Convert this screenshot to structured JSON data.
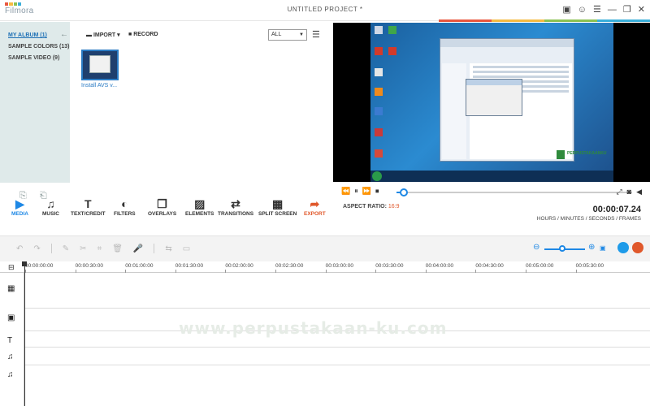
{
  "app": {
    "logo_text": "Filmora",
    "window_title": "UNTITLED PROJECT *",
    "logo_colors": [
      "#e9573f",
      "#f6bb42",
      "#8cc152",
      "#3bafda"
    ]
  },
  "window_controls": {
    "icons": [
      "save-icon",
      "user-icon",
      "menu-icon",
      "minimize-icon",
      "maximize-icon",
      "close-icon"
    ],
    "glyphs": [
      "▣",
      "☺",
      "☰",
      "—",
      "❐",
      "✕"
    ]
  },
  "library": {
    "albums": [
      {
        "label": "MY ALBUM (1)",
        "active": true
      },
      {
        "label": "SAMPLE COLORS (13)",
        "active": false
      },
      {
        "label": "SAMPLE VIDEO (9)",
        "active": false
      }
    ]
  },
  "media": {
    "import_label": "IMPORT",
    "record_label": "RECORD",
    "filter_value": "ALL",
    "clip_label": "Install AVS v..."
  },
  "preview": {
    "aspect_label": "ASPECT RATIO:",
    "aspect_value": "16:9",
    "timecode": "00:00:07.24",
    "timecode_format": "HOURS / MINUTES / SECONDS / FRAMES",
    "overlay_brand": "PERPUSTAKAANKU",
    "playback_progress": 0.03
  },
  "toolbar": {
    "tools": [
      {
        "label": "MEDIA",
        "icon": "media-icon",
        "glyph": "▶",
        "active": true
      },
      {
        "label": "MUSIC",
        "icon": "music-icon",
        "glyph": "♫",
        "active": false
      },
      {
        "label": "TEXT/CREDIT",
        "icon": "text-icon",
        "glyph": "T",
        "active": false
      },
      {
        "label": "FILTERS",
        "icon": "filters-icon",
        "glyph": "◐",
        "active": false
      },
      {
        "label": "OVERLAYS",
        "icon": "overlays-icon",
        "glyph": "❐",
        "active": false
      },
      {
        "label": "ELEMENTS",
        "icon": "elements-icon",
        "glyph": "▨",
        "active": false
      },
      {
        "label": "TRANSITIONS",
        "icon": "transitions-icon",
        "glyph": "⇄",
        "active": false
      },
      {
        "label": "SPLIT SCREEN",
        "icon": "split-screen-icon",
        "glyph": "▦",
        "active": false
      },
      {
        "label": "EXPORT",
        "icon": "export-icon",
        "glyph": "➦",
        "active": false
      }
    ]
  },
  "timeline": {
    "ticks": [
      "00:00:00:00",
      "00:00:30:00",
      "00:01:00:00",
      "00:01:30:00",
      "00:02:00:00",
      "00:02:30:00",
      "00:03:00:00",
      "00:03:30:00",
      "00:04:00:00",
      "00:04:30:00",
      "00:05:00:00",
      "00:05:30:00"
    ],
    "tracks": [
      {
        "icon": "video-track-icon",
        "glyph": "▦"
      },
      {
        "icon": "image-track-icon",
        "glyph": "▣"
      },
      {
        "icon": "text-track-icon",
        "glyph": "T"
      },
      {
        "icon": "music-track-icon",
        "glyph": "♫"
      },
      {
        "icon": "music-track-2-icon",
        "glyph": "♫"
      }
    ]
  },
  "watermark": "www.perpustakaan-ku.com",
  "colors": {
    "accent": "#1e88e5",
    "export": "#e0582b",
    "library_bg": "#dfeaea"
  }
}
